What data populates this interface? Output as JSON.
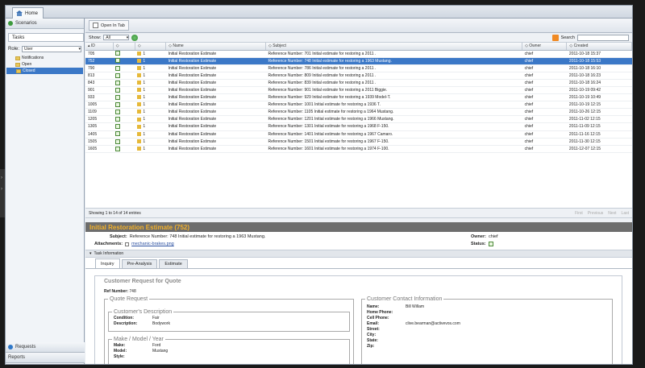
{
  "home_tab": "Home",
  "sidebar": {
    "scenarios": "Scenarios",
    "tasks_tab": "Tasks",
    "role_label": "Role:",
    "role_value": "User",
    "tree": [
      "Notifications",
      "Open",
      "Closed"
    ],
    "selected_tree": "Closed",
    "requests": "Requests",
    "reports": "Reports"
  },
  "toolbar": {
    "open_in_tab": "Open In Tab",
    "show_label": "Show:",
    "show_value": "All",
    "search_label": "Search"
  },
  "grid": {
    "columns": [
      "ID",
      "",
      "",
      "Name",
      "Subject",
      "Owner",
      "Created"
    ],
    "rows": [
      {
        "id": "705",
        "pri": "1",
        "name": "Initial Restoration Estimate",
        "subject": "Reference Number: 701 Initial estimate for restoring a 2011 .",
        "owner": "chief",
        "created": "2011-10-18 15:37"
      },
      {
        "id": "752",
        "pri": "1",
        "name": "Initial Restoration Estimate",
        "subject": "Reference Number: 748 Initial estimate for restoring a 1963 Mustang.",
        "owner": "chief",
        "created": "2011-10-18 15:53"
      },
      {
        "id": "790",
        "pri": "1",
        "name": "Initial Restoration Estimate",
        "subject": "Reference Number: 786 Initial estimate for restoring a 2011 .",
        "owner": "chief",
        "created": "2011-10-18 16:10"
      },
      {
        "id": "813",
        "pri": "1",
        "name": "Initial Restoration Estimate",
        "subject": "Reference Number: 809 Initial estimate for restoring a 2011 .",
        "owner": "chief",
        "created": "2011-10-18 16:23"
      },
      {
        "id": "843",
        "pri": "1",
        "name": "Initial Restoration Estimate",
        "subject": "Reference Number: 839 Initial estimate for restoring a 2011 .",
        "owner": "chief",
        "created": "2011-10-18 16:24"
      },
      {
        "id": "901",
        "pri": "1",
        "name": "Initial Restoration Estimate",
        "subject": "Reference Number: 901 Initial estimate for restoring a 2011 Biggie.",
        "owner": "chief",
        "created": "2011-10-19 09:42"
      },
      {
        "id": "933",
        "pri": "1",
        "name": "Initial Restoration Estimate",
        "subject": "Reference Number: 929 Initial estimate for restoring a 1939 Model-T.",
        "owner": "chief",
        "created": "2011-10-19 10:49"
      },
      {
        "id": "1005",
        "pri": "1",
        "name": "Initial Restoration Estimate",
        "subject": "Reference Number: 1001 Initial estimate for restoring a 1936 T.",
        "owner": "chief",
        "created": "2011-10-19 12:15"
      },
      {
        "id": "1109",
        "pri": "1",
        "name": "Initial Restoration Estimate",
        "subject": "Reference Number: 1105 Initial estimate for restoring a 1964 Mustang.",
        "owner": "chief",
        "created": "2011-10-26 12:15"
      },
      {
        "id": "1205",
        "pri": "1",
        "name": "Initial Restoration Estimate",
        "subject": "Reference Number: 1201 Initial estimate for restoring a 1966 Mustang.",
        "owner": "chief",
        "created": "2011-11-02 12:15"
      },
      {
        "id": "1305",
        "pri": "1",
        "name": "Initial Restoration Estimate",
        "subject": "Reference Number: 1301 Initial estimate for restoring a 1968 F-150.",
        "owner": "chief",
        "created": "2011-11-09 12:15"
      },
      {
        "id": "1405",
        "pri": "1",
        "name": "Initial Restoration Estimate",
        "subject": "Reference Number: 1401 Initial estimate for restoring a 1967 Camaro.",
        "owner": "chief",
        "created": "2011-11-16 12:15"
      },
      {
        "id": "1505",
        "pri": "1",
        "name": "Initial Restoration Estimate",
        "subject": "Reference Number: 1501 Initial estimate for restoring a 1967 F-150.",
        "owner": "chief",
        "created": "2011-11-30 12:15"
      },
      {
        "id": "1605",
        "pri": "1",
        "name": "Initial Restoration Estimate",
        "subject": "Reference Number: 1601 Initial estimate for restoring a 1974 F-100.",
        "owner": "chief",
        "created": "2011-12-07 12:15"
      }
    ],
    "selected_id": "752"
  },
  "pager": {
    "summary": "Showing 1 to 14 of 14 entries",
    "first": "First",
    "previous": "Previous",
    "next": "Next",
    "last": "Last"
  },
  "detail": {
    "title": "Initial Restoration Estimate (752)",
    "subject_label": "Subject:",
    "subject_value": "Reference Number: 748 Initial estimate for restoring a 1963 Mustang.",
    "attachments_label": "Attachments:",
    "attachment_name": "mechanic-brakes.png",
    "owner_label": "Owner:",
    "owner_value": "chief",
    "status_label": "Status:",
    "task_info": "Task Information",
    "tabs": [
      "Inquiry",
      "Pre-Analysis",
      "Estimate"
    ],
    "form": {
      "title": "Customer Request for Quote",
      "ref_label": "Ref Number:",
      "ref_value": "748",
      "quote_request": "Quote Request",
      "customer_description": "Customer's Description",
      "condition_label": "Condition:",
      "condition_value": "Fair",
      "description_label": "Description:",
      "description_value": "Bodywork",
      "make_model_year": "Make / Model / Year",
      "make_label": "Make:",
      "make_value": "Ford",
      "model_label": "Model:",
      "model_value": "Mustang",
      "style_label": "Style:",
      "contact_title": "Customer Contact Information",
      "name_label": "Name:",
      "name_value": "Bill Willam",
      "home_phone_label": "Home Phone:",
      "cell_phone_label": "Cell Phone:",
      "email_label": "Email:",
      "email_value": "clive.bearman@activevos.com",
      "street_label": "Street:",
      "city_label": "City:",
      "state_label": "State:",
      "zip_label": "Zip:"
    }
  }
}
